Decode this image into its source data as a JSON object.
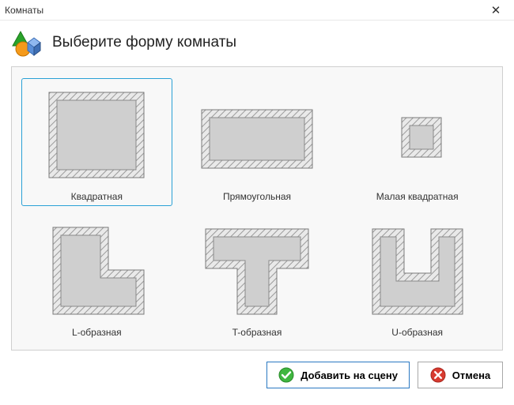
{
  "window": {
    "title": "Комнаты"
  },
  "header": {
    "title": "Выберите форму комнаты"
  },
  "shapes": [
    {
      "label": "Квадратная",
      "selected": true
    },
    {
      "label": "Прямоугольная",
      "selected": false
    },
    {
      "label": "Малая квадратная",
      "selected": false
    },
    {
      "label": "L-образная",
      "selected": false
    },
    {
      "label": "T-образная",
      "selected": false
    },
    {
      "label": "U-образная",
      "selected": false
    }
  ],
  "buttons": {
    "add": "Добавить на сцену",
    "cancel": "Отмена"
  }
}
